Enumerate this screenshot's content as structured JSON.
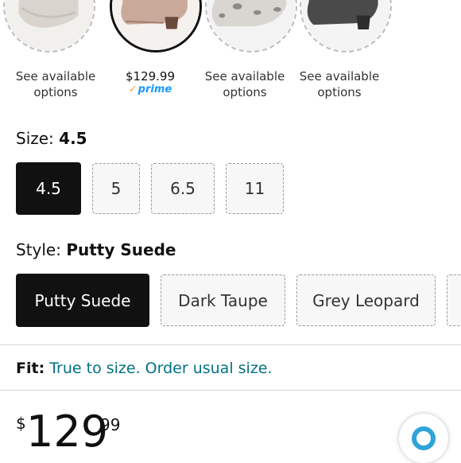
{
  "swatches": [
    {
      "caption_line1": "See available",
      "caption_line2": "options"
    },
    {
      "price": "$129.99",
      "badge": "prime",
      "badge_check": "✓"
    },
    {
      "caption_line1": "See available",
      "caption_line2": "options"
    },
    {
      "caption_line1": "See available",
      "caption_line2": "options"
    }
  ],
  "size": {
    "label": "Size:",
    "selected": "4.5",
    "options": [
      "4.5",
      "5",
      "6.5",
      "11"
    ]
  },
  "style": {
    "label": "Style:",
    "selected": "Putty Suede",
    "options": [
      "Putty Suede",
      "Dark Taupe",
      "Grey Leopard"
    ]
  },
  "fit": {
    "label": "Fit:",
    "value": "True to size. Order usual size."
  },
  "price": {
    "currency": "$",
    "whole": "129",
    "fraction": "99"
  },
  "colors": {
    "accent_link": "#007185",
    "prime_blue": "#1a98ff",
    "selected_bg": "#111111",
    "assistant_ring": "#2fa4d8"
  },
  "icons": {
    "assistant": "alexa-ring-icon"
  }
}
